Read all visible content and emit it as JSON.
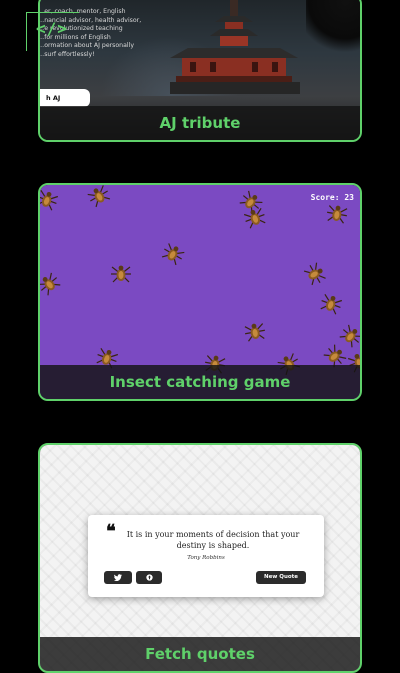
{
  "logo": {
    "text": "</>"
  },
  "cards": [
    {
      "title": "AJ tribute",
      "text_lines": [
        "…er, coach, mentor, English",
        "…nancial advisor, health advisor,",
        "…e revolutionized teaching",
        "…for millions of English",
        "…ormation about AJ personally",
        "…surf effortlessly!"
      ],
      "button_label": "h AJ"
    },
    {
      "title": "Insect catching game",
      "score_label": "Score: 23"
    },
    {
      "title": "Fetch quotes",
      "quote_mark": "❝",
      "quote": "It is in your moments of decision that your destiny is shaped.",
      "author": "Tony Robbins",
      "buttons": {
        "twitter_icon": "twitter-icon",
        "tumblr_icon": "tumblr-icon",
        "new_quote": "New Quote"
      }
    }
  ],
  "colors": {
    "accent": "#5fd16a",
    "game_bg": "#7b4ac2",
    "background": "#000000"
  }
}
